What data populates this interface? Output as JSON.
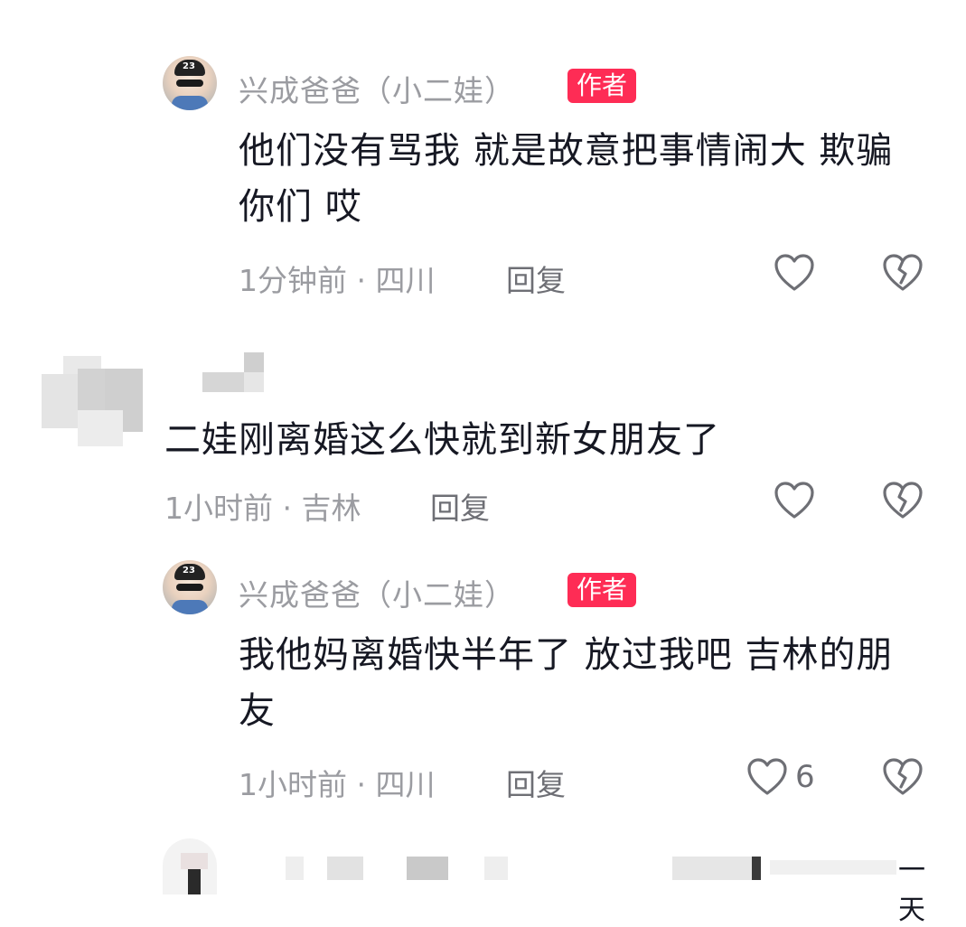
{
  "comments": [
    {
      "username": "兴成爸爸（小二娃）",
      "badge": "作者",
      "text": "他们没有骂我 就是故意把事情闹大 欺骗你们 哎",
      "time": "1分钟前",
      "location": "四川",
      "reply_label": "回复",
      "like_count": ""
    },
    {
      "username": "",
      "text": "二娃刚离婚这么快就到新女朋友了",
      "time": "1小时前",
      "location": "吉林",
      "reply_label": "回复",
      "like_count": ""
    },
    {
      "username": "兴成爸爸（小二娃）",
      "badge": "作者",
      "text": "我他妈离婚快半年了 放过我吧 吉林的朋友",
      "time": "1小时前",
      "location": "四川",
      "reply_label": "回复",
      "like_count": "6"
    }
  ],
  "footer_partial": {
    "time_fragment": "一天"
  },
  "icons": {
    "like": "heart-outline-icon",
    "dislike": "broken-heart-icon"
  },
  "colors": {
    "badge_bg": "#fe2c55",
    "meta": "#9b9ca1",
    "text": "#161823"
  }
}
